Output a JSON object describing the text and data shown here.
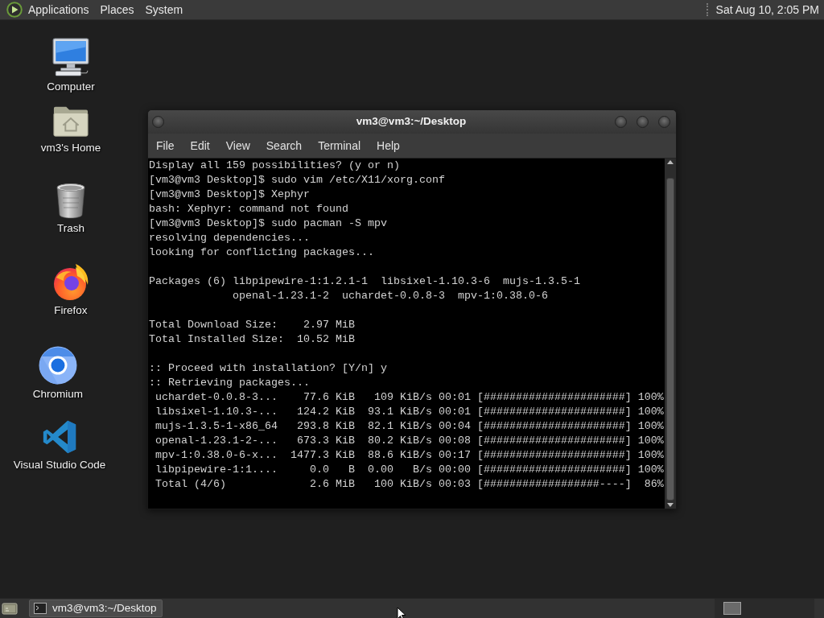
{
  "top_panel": {
    "menus": [
      "Applications",
      "Places",
      "System"
    ],
    "clock": "Sat Aug 10, 2:05 PM"
  },
  "desktop_icons": [
    {
      "kind": "computer",
      "label": "Computer"
    },
    {
      "kind": "home",
      "label": "vm3's Home"
    },
    {
      "kind": "trash",
      "label": "Trash"
    },
    {
      "kind": "firefox",
      "label": "Firefox"
    },
    {
      "kind": "chromium",
      "label": "Chromium"
    },
    {
      "kind": "vscode",
      "label": "Visual Studio Code"
    }
  ],
  "terminal": {
    "title": "vm3@vm3:~/Desktop",
    "menu": [
      "File",
      "Edit",
      "View",
      "Search",
      "Terminal",
      "Help"
    ],
    "output_blocks": [
      [
        "Display all 159 possibilities? (y or n)",
        "[vm3@vm3 Desktop]$ sudo vim /etc/X11/xorg.conf",
        "[vm3@vm3 Desktop]$ Xephyr",
        "bash: Xephyr: command not found",
        "[vm3@vm3 Desktop]$ sudo pacman -S mpv",
        "resolving dependencies...",
        "looking for conflicting packages..."
      ],
      [
        "Packages (6) libpipewire-1:1.2.1-1  libsixel-1.10.3-6  mujs-1.3.5-1",
        "             openal-1.23.1-2  uchardet-0.0.8-3  mpv-1:0.38.0-6"
      ],
      [
        "Total Download Size:    2.97 MiB",
        "Total Installed Size:  10.52 MiB"
      ],
      [
        ":: Proceed with installation? [Y/n] y",
        ":: Retrieving packages...",
        " uchardet-0.0.8-3...    77.6 KiB   109 KiB/s 00:01 [######################] 100%",
        " libsixel-1.10.3-...   124.2 KiB  93.1 KiB/s 00:01 [######################] 100%",
        " mujs-1.3.5-1-x86_64   293.8 KiB  82.1 KiB/s 00:04 [######################] 100%",
        " openal-1.23.1-2-...   673.3 KiB  80.2 KiB/s 00:08 [######################] 100%",
        " mpv-1:0.38.0-6-x...  1477.3 KiB  88.6 KiB/s 00:17 [######################] 100%",
        " libpipewire-1:1....     0.0   B  0.00   B/s 00:00 [######################] 100%",
        " Total (4/6)             2.6 MiB   100 KiB/s 00:03 [##################----]  86%"
      ]
    ]
  },
  "taskbar": {
    "tasks": [
      {
        "label": "vm3@vm3:~/Desktop",
        "selected": true
      }
    ]
  }
}
